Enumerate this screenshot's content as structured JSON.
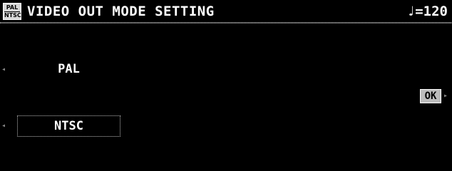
{
  "header": {
    "icon_line1": "PAL",
    "icon_line2": "NTSC",
    "title": "VIDEO OUT MODE SETTING",
    "tempo": "♩=120"
  },
  "options": [
    {
      "label": "PAL",
      "selected": false
    },
    {
      "label": "NTSC",
      "selected": true
    }
  ],
  "ok_label": "OK",
  "arrows": {
    "left": "◂",
    "right": "▸"
  },
  "icons": {
    "mode_icon": "pal-ntsc-icon",
    "side_arrow": "left-arrow-icon",
    "ok_arrow": "right-arrow-icon"
  }
}
